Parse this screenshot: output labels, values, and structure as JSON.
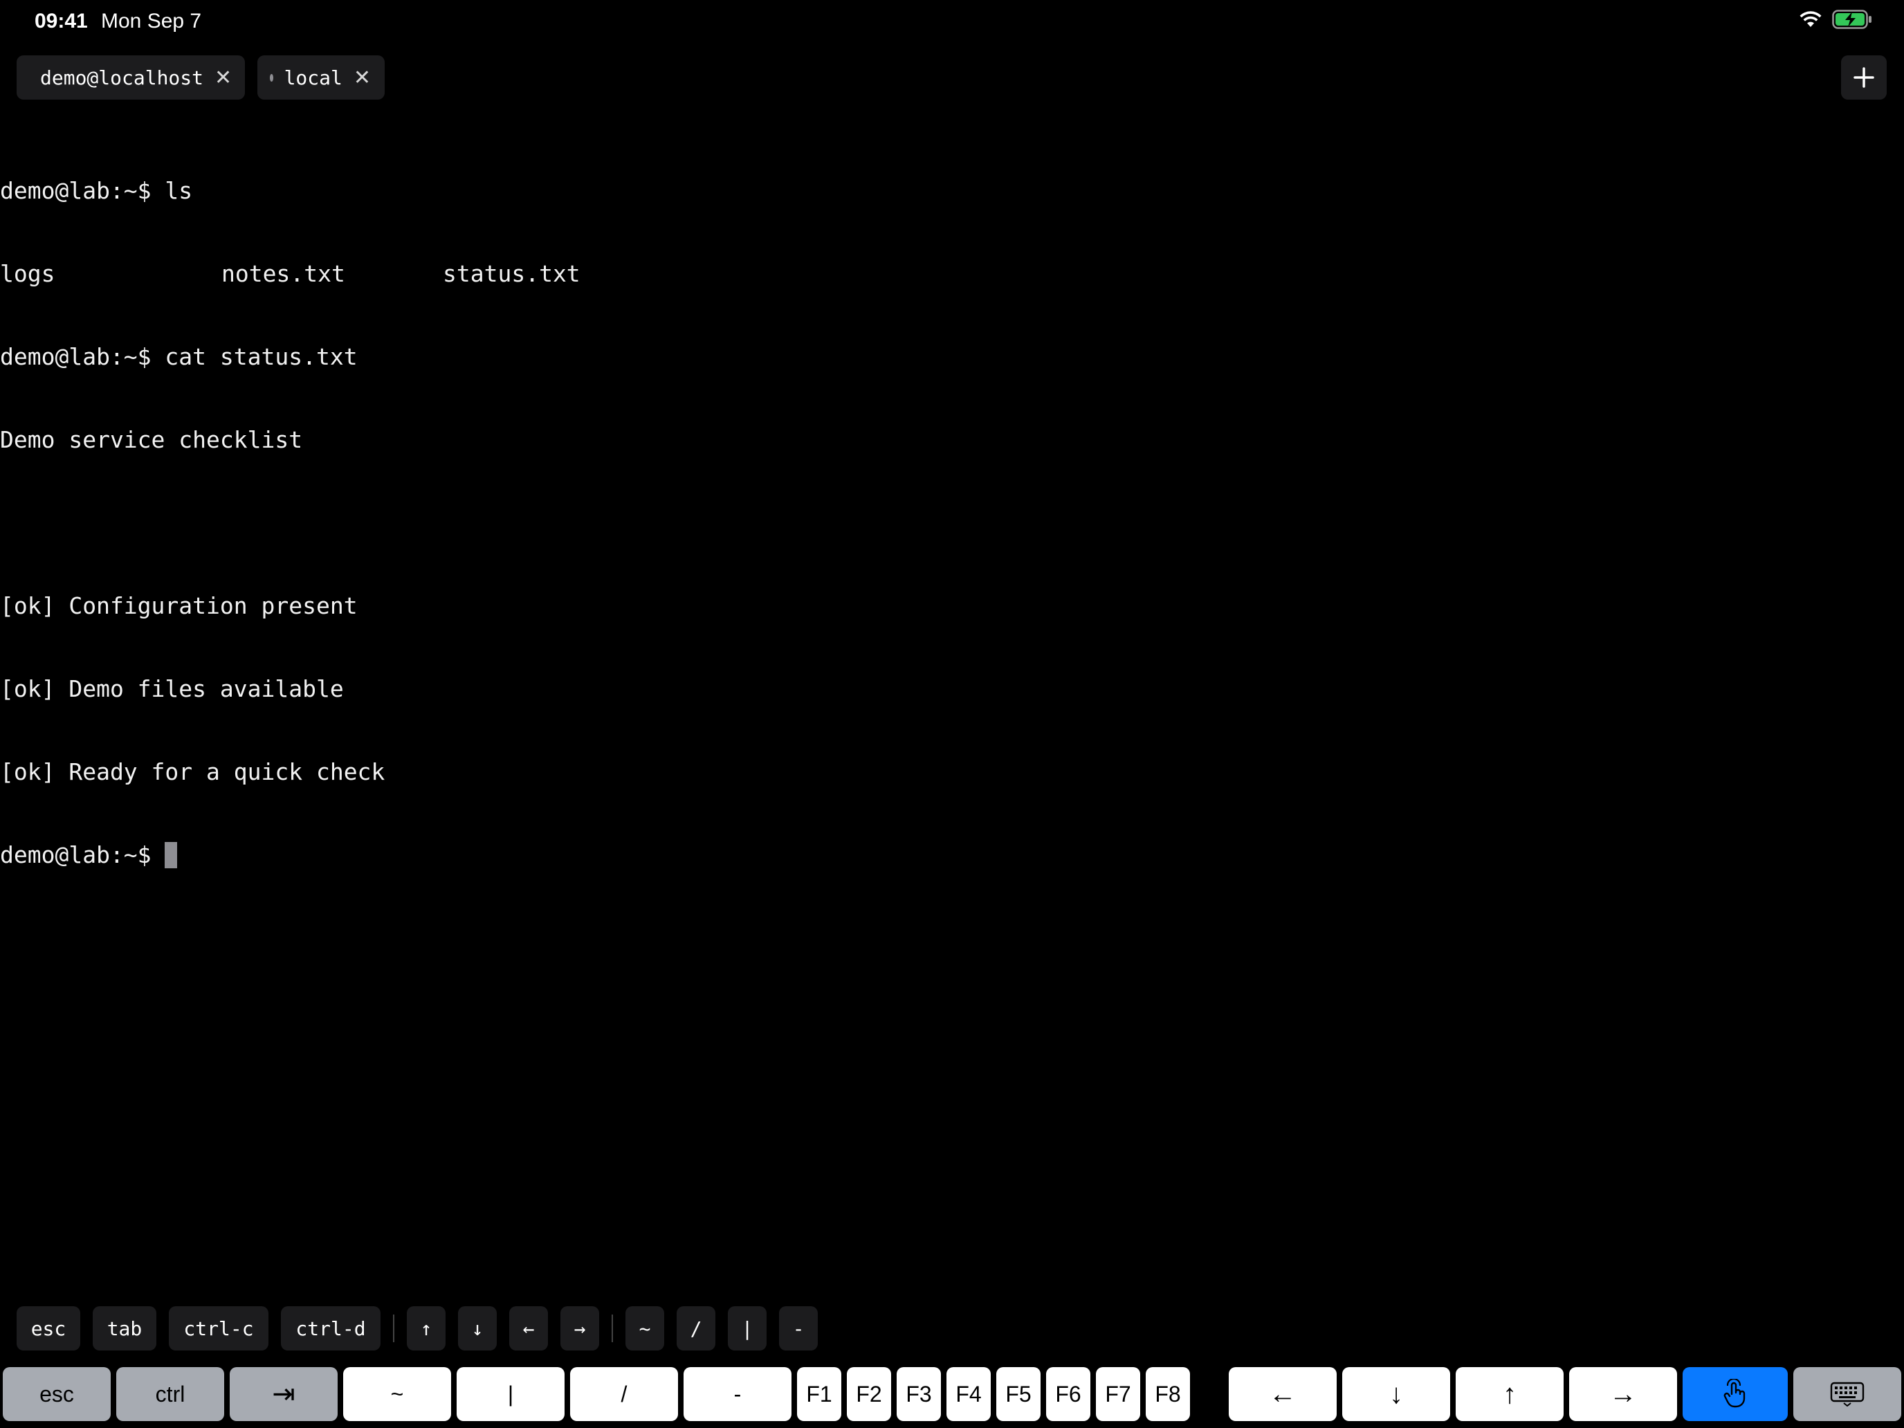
{
  "status_bar": {
    "time": "09:41",
    "date": "Mon Sep 7",
    "icons": [
      "wifi-icon",
      "battery-charging-icon"
    ],
    "battery_color": "#34c759"
  },
  "tabs": [
    {
      "label": "demo@localhost",
      "dot_color": "#30d158",
      "active": true
    },
    {
      "label": "local",
      "dot_color": "#8e8e93",
      "active": false
    }
  ],
  "terminal": {
    "prompt": "demo@lab:~$",
    "lines": [
      {
        "kind": "command",
        "text": "ls"
      },
      {
        "kind": "columns",
        "cols": [
          "logs",
          "notes.txt",
          "status.txt"
        ]
      },
      {
        "kind": "command",
        "text": "cat status.txt"
      },
      {
        "kind": "output",
        "text": "Demo service checklist"
      },
      {
        "kind": "output",
        "text": ""
      },
      {
        "kind": "output",
        "text": "[ok] Configuration present"
      },
      {
        "kind": "output",
        "text": "[ok] Demo files available"
      },
      {
        "kind": "output",
        "text": "[ok] Ready for a quick check"
      },
      {
        "kind": "command",
        "text": "",
        "cursor": true
      }
    ]
  },
  "accessory_keys": {
    "group1": [
      "esc",
      "tab",
      "ctrl-c",
      "ctrl-d"
    ],
    "group2": [
      "↑",
      "↓",
      "←",
      "→"
    ],
    "group3": [
      "~",
      "/",
      "|",
      "-"
    ]
  },
  "keyboard": {
    "left_keys": [
      {
        "label": "esc",
        "style": "gray"
      },
      {
        "label": "ctrl",
        "style": "gray"
      },
      {
        "label": "⇥",
        "style": "gray"
      },
      {
        "label": "~",
        "style": "white"
      },
      {
        "label": "|",
        "style": "white"
      },
      {
        "label": "/",
        "style": "white"
      },
      {
        "label": "-",
        "style": "white"
      }
    ],
    "function_keys": [
      "F1",
      "F2",
      "F3",
      "F4",
      "F5",
      "F6",
      "F7",
      "F8"
    ],
    "arrow_keys": [
      "←",
      "↓",
      "↑",
      "→"
    ],
    "accent_color": "#0a7aff"
  }
}
